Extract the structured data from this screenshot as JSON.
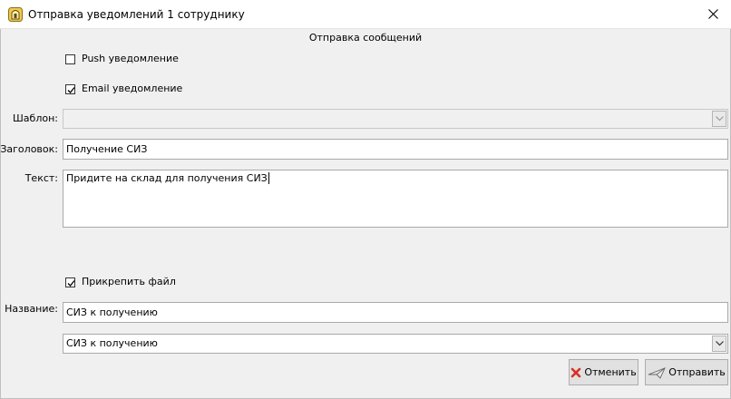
{
  "window": {
    "title": "Отправка уведомлений 1 сотруднику"
  },
  "section": {
    "title": "Отправка сообщений"
  },
  "push": {
    "label": "Push уведомление",
    "checked": false
  },
  "email": {
    "label": "Email уведомление",
    "checked": true
  },
  "template": {
    "label": "Шаблон:",
    "value": ""
  },
  "subject": {
    "label": "Заголовок:",
    "value": "Получение СИЗ"
  },
  "text": {
    "label": "Текст:",
    "value": "Придите на склад для получения СИЗ"
  },
  "attach": {
    "label": "Прикрепить файл",
    "checked": true
  },
  "filename": {
    "label": "Название:",
    "value": "СИЗ к получению"
  },
  "file_select": {
    "value": "СИЗ к получению"
  },
  "buttons": {
    "cancel": "Отменить",
    "send": "Отправить"
  }
}
